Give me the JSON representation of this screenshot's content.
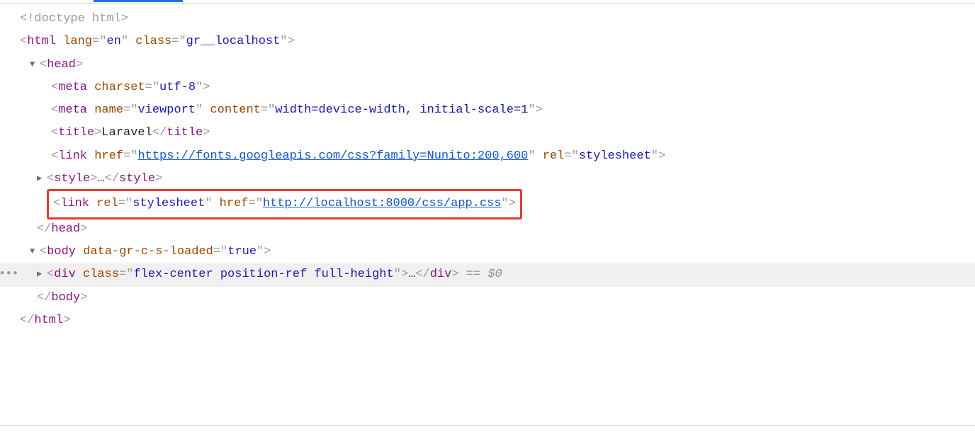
{
  "doctype": "<!doctype html>",
  "html_open": {
    "tag": "html",
    "attrs": [
      [
        "lang",
        "en"
      ],
      [
        "class",
        "gr__localhost"
      ]
    ]
  },
  "head_open": "head",
  "meta1": {
    "tag": "meta",
    "attrs": [
      [
        "charset",
        "utf-8"
      ]
    ]
  },
  "meta2": {
    "tag": "meta",
    "attrs": [
      [
        "name",
        "viewport"
      ],
      [
        "content",
        "width=device-width, initial-scale=1"
      ]
    ]
  },
  "title": {
    "tag": "title",
    "text": "Laravel"
  },
  "link1": {
    "tag": "link",
    "attrs_pre": [
      [
        "href_url",
        "https://fonts.googleapis.com/css?family=Nunito:200,600"
      ],
      [
        "rel",
        "stylesheet"
      ]
    ]
  },
  "style_line": {
    "tag": "style",
    "dots": "…"
  },
  "link2": {
    "tag": "link",
    "attrs": [
      [
        "rel",
        "stylesheet"
      ],
      [
        "href_url",
        "http://localhost:8000/css/app.css"
      ]
    ]
  },
  "head_close": "head",
  "body_open": {
    "tag": "body",
    "attrs": [
      [
        "data-gr-c-s-loaded",
        "true"
      ]
    ]
  },
  "div_line": {
    "tag": "div",
    "attrs": [
      [
        "class",
        "flex-center position-ref full-height"
      ]
    ],
    "dots": "…",
    "suffix": " == $0"
  },
  "body_close": "body",
  "html_close": "html",
  "gutter": "•••"
}
